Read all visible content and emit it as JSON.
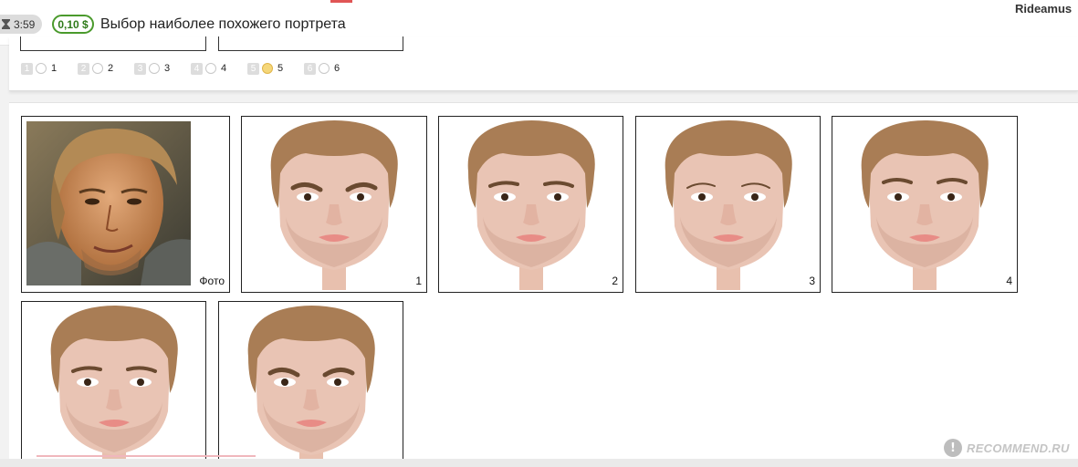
{
  "header": {
    "timer": "3:59",
    "reward": "0,10 $",
    "title": "Выбор наиболее похожего портрета",
    "username": "Rideamus"
  },
  "options": [
    {
      "key": "1",
      "label": "1",
      "selected": false
    },
    {
      "key": "2",
      "label": "2",
      "selected": false
    },
    {
      "key": "3",
      "label": "3",
      "selected": false
    },
    {
      "key": "4",
      "label": "4",
      "selected": false
    },
    {
      "key": "5",
      "label": "5",
      "selected": true
    },
    {
      "key": "6",
      "label": "6",
      "selected": false
    }
  ],
  "photo_card": {
    "label": "Фото"
  },
  "portraits": [
    {
      "label": "1",
      "variant": "frown-brows"
    },
    {
      "label": "2",
      "variant": "neutral"
    },
    {
      "label": "3",
      "variant": "thin-brows"
    },
    {
      "label": "4",
      "variant": "soft-brows"
    },
    {
      "label": "",
      "variant": "neutral-b"
    },
    {
      "label": "",
      "variant": "frown-brows-b"
    }
  ],
  "watermark": {
    "symbol": "!",
    "text": "RECOMMEND.RU"
  },
  "colors": {
    "accent_green": "#4a9a2c",
    "selected_radio": "#f5d77a",
    "hair": "#a97d55",
    "skin": "#e9c4b4"
  }
}
